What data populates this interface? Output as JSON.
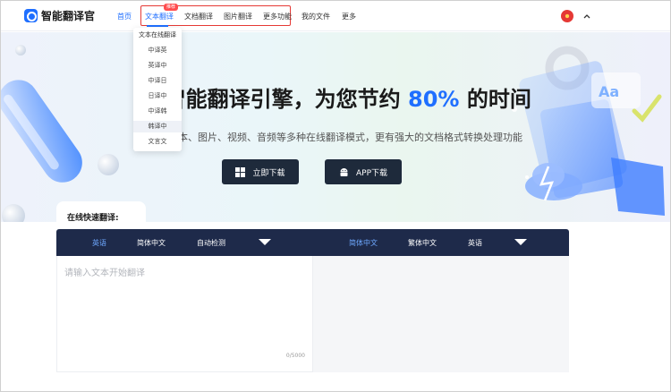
{
  "app": {
    "title": "智能翻译官"
  },
  "nav": {
    "items": [
      {
        "label": "首页",
        "active": true
      },
      {
        "label": "文本翻译",
        "active": true
      },
      {
        "label": "文档翻译"
      },
      {
        "label": "图片翻译"
      },
      {
        "label": "更多功能"
      },
      {
        "label": "我的文件"
      },
      {
        "label": "更多"
      }
    ],
    "badge": "推荐"
  },
  "dropdown": {
    "items": [
      "文本在线翻译",
      "中译英",
      "英译中",
      "中译日",
      "日译中",
      "中译韩",
      "韩译中",
      "文言文"
    ],
    "hover_index": 6
  },
  "hero": {
    "title_before": "AI智能翻译引擎，为您节约",
    "title_accent": "80%",
    "title_after": "的时间",
    "subtitle": "涵盖文本、图片、视频、音频等多种在线翻译模式，更有强大的文档格式转换处理功能",
    "btn_download": "立即下载",
    "btn_app": "APP下载"
  },
  "translator": {
    "quick_label": "在线快速翻译:",
    "source_langs": [
      "英语",
      "简体中文",
      "自动检测"
    ],
    "source_active_index": 0,
    "target_langs": [
      "简体中文",
      "繁体中文",
      "英语"
    ],
    "target_active_index": 0,
    "placeholder": "请输入文本开始翻译",
    "char_count": "0/5000"
  },
  "colors": {
    "accent": "#1f6fff",
    "lang_bar": "#1e2a4a",
    "button": "#1e2a3b",
    "highlight_border": "#e53935"
  },
  "icons": {
    "logo": "logo-icon",
    "windows": "windows-icon",
    "android": "android-icon",
    "chevron": "chevron-up-icon",
    "caret": "caret-down-icon"
  }
}
